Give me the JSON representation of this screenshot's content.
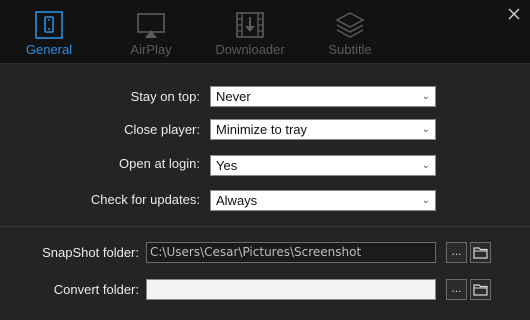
{
  "tabs": [
    {
      "label": "General",
      "icon": "phone-icon",
      "active": true
    },
    {
      "label": "AirPlay",
      "icon": "airplay-icon",
      "active": false
    },
    {
      "label": "Downloader",
      "icon": "film-download-icon",
      "active": false
    },
    {
      "label": "Subtitle",
      "icon": "layers-icon",
      "active": false
    }
  ],
  "colors": {
    "accent": "#2a8ee0",
    "tab_inactive": "#5a5a5a",
    "background": "#242424"
  },
  "settings": {
    "stay_on_top": {
      "label": "Stay on top:",
      "value": "Never"
    },
    "close_player": {
      "label": "Close player:",
      "value": "Minimize to tray"
    },
    "open_at_login": {
      "label": "Open at login:",
      "value": "Yes"
    },
    "check_updates": {
      "label": "Check for updates:",
      "value": "Always"
    }
  },
  "folders": {
    "snapshot": {
      "label": "SnapShot folder:",
      "value": "C:\\Users\\Cesar\\Pictures\\Screenshot"
    },
    "convert": {
      "label": "Convert folder:",
      "value": ""
    }
  },
  "browse_label": "..."
}
